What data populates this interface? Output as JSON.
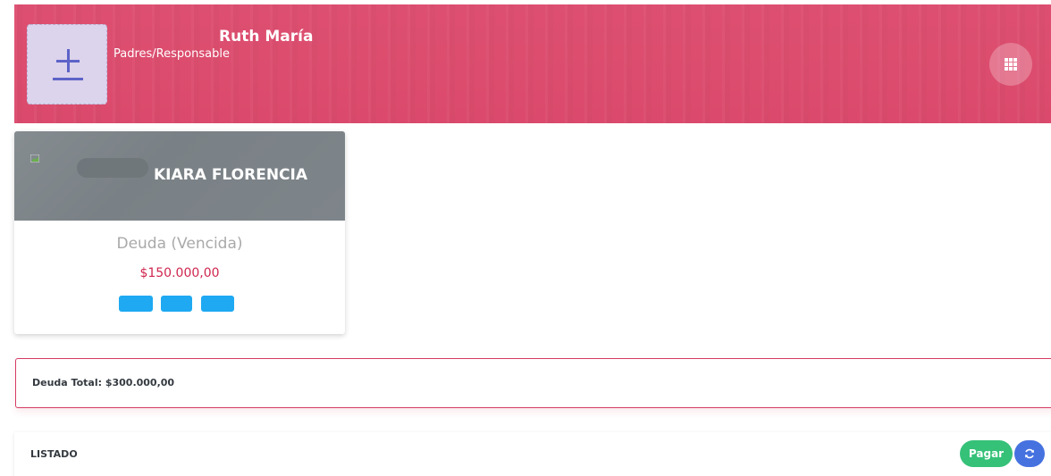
{
  "header": {
    "user_name": "Ruth María",
    "user_role": "Padres/Responsable",
    "avatar_icon": "add-photo-icon",
    "apps_icon": "apps-grid-icon",
    "color": "#dc4d6e"
  },
  "student_card": {
    "name": "KIARA FLORENCIA",
    "image_icon": "broken-image-icon",
    "debt_label": "Deuda (Vencida)",
    "debt_amount": "$150.000,00",
    "action_buttons": [
      "",
      "",
      ""
    ],
    "button_color": "#1ea9f2",
    "amount_color": "#d0264f"
  },
  "summary": {
    "total_text": "Deuda Total: $300.000,00"
  },
  "list": {
    "title": "LISTADO",
    "pay_label": "Pagar",
    "pay_color": "#35c178",
    "refresh_icon": "refresh-icon",
    "refresh_color": "#4672e0"
  }
}
